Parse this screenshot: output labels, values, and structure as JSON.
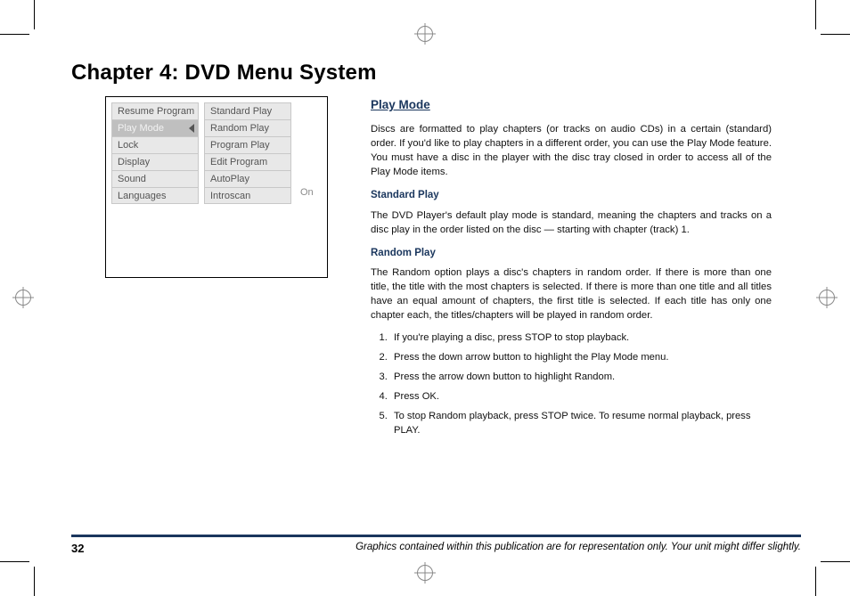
{
  "chapter_title": "Chapter 4: DVD Menu System",
  "menu": {
    "left": [
      {
        "label": "Resume Program",
        "selected": false
      },
      {
        "label": "Play Mode",
        "selected": true
      },
      {
        "label": "Lock",
        "selected": false
      },
      {
        "label": "Display",
        "selected": false
      },
      {
        "label": "Sound",
        "selected": false
      },
      {
        "label": "Languages",
        "selected": false
      }
    ],
    "right": [
      {
        "label": "Standard Play"
      },
      {
        "label": "Random Play"
      },
      {
        "label": "Program Play"
      },
      {
        "label": "Edit Program"
      },
      {
        "label": "AutoPlay",
        "value": "On"
      },
      {
        "label": "Introscan"
      }
    ]
  },
  "content": {
    "h_play_mode": "Play Mode",
    "p_intro": "Discs are formatted to play chapters (or tracks on audio CDs) in a certain (standard) order. If you'd like to play chapters in a different order, you can use the Play Mode feature. You must have a disc in the player with the disc tray closed in order to access all of the Play Mode items.",
    "h_standard": "Standard Play",
    "p_standard": "The DVD Player's default play mode is standard, meaning the chapters and tracks on a disc play in the order listed on the disc — starting with chapter (track) 1.",
    "h_random": "Random Play",
    "p_random": "The Random option plays a disc's chapters in random order. If there is more than one title, the title with the most chapters is selected. If there is more than one title and all titles have an equal amount of chapters, the first title is selected. If each title has only one chapter each, the titles/chapters will be played in random order.",
    "steps": [
      "If you're playing a disc, press STOP to stop playback.",
      "Press the down arrow button to highlight the Play Mode menu.",
      "Press the arrow down button to highlight Random.",
      "Press OK.",
      "To stop Random playback, press STOP twice. To resume normal playback, press PLAY."
    ]
  },
  "footer": {
    "page_number": "32",
    "note": "Graphics contained within this publication are for representation only. Your unit might differ slightly."
  }
}
